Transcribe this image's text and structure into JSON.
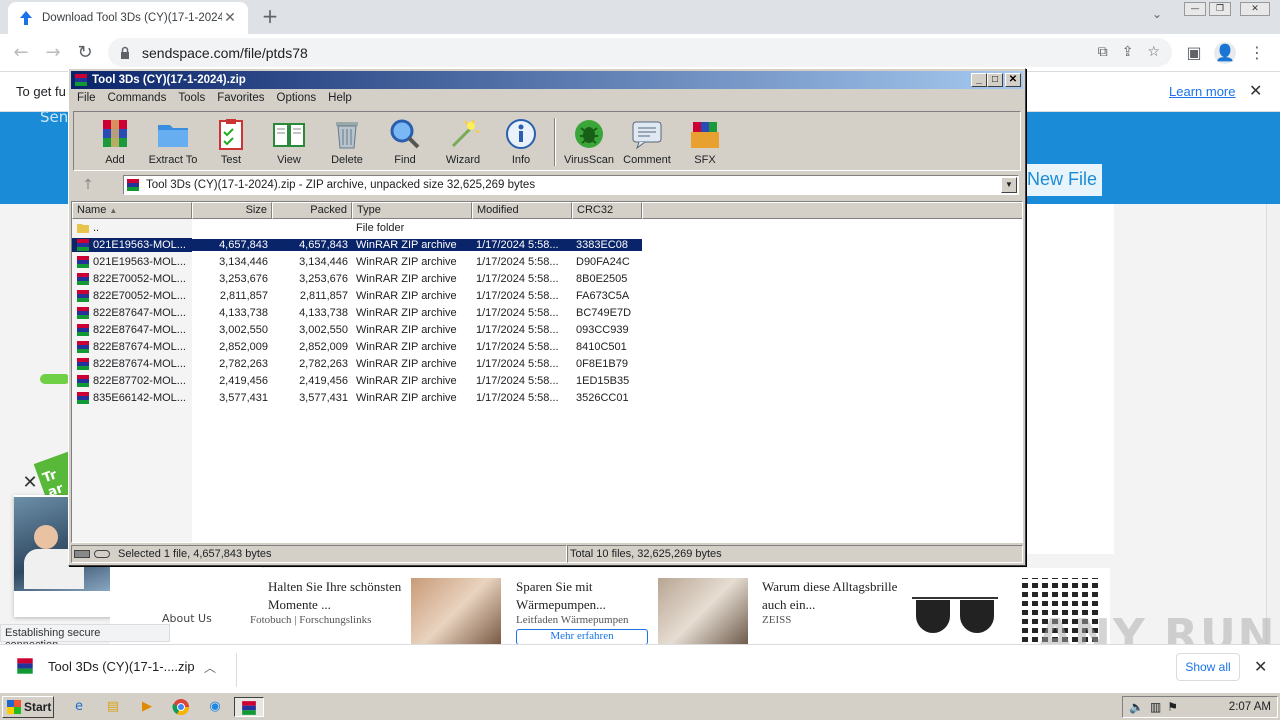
{
  "browser": {
    "tab_title": "Download Tool 3Ds (CY)(17-1-2024)",
    "url": "sendspace.com/file/ptds78"
  },
  "page": {
    "infobar_text": "To get fu",
    "learn_more": "Learn more",
    "banner_text": "Sen",
    "new_file_button": "New File",
    "badge_text": "Tr ar",
    "status_text": "Establishing secure connection...",
    "about_us": "About Us",
    "ads": [
      {
        "title": "Halten Sie Ihre schönsten Momente ...",
        "sub": "Fotobuch | Forschungslinks"
      },
      {
        "title": "Sparen Sie mit Wärmepumpen...",
        "sub": "Leitfaden Wärmepumpen",
        "button": "Mehr erfahren"
      },
      {
        "title": "Warum diese Alltagsbrille auch ein...",
        "sub": "ZEISS"
      }
    ],
    "watermark": "ANY RUN"
  },
  "downloads": {
    "item_name": "Tool 3Ds (CY)(17-1-....zip",
    "show_all": "Show all"
  },
  "taskbar": {
    "start": "Start",
    "clock": "2:07 AM"
  },
  "winrar": {
    "title": "Tool 3Ds (CY)(17-1-2024).zip",
    "menu": [
      "File",
      "Commands",
      "Tools",
      "Favorites",
      "Options",
      "Help"
    ],
    "tools": [
      {
        "label": "Add",
        "icon": "add-archive-icon"
      },
      {
        "label": "Extract To",
        "icon": "extract-folder-icon"
      },
      {
        "label": "Test",
        "icon": "test-clipboard-icon"
      },
      {
        "label": "View",
        "icon": "view-book-icon"
      },
      {
        "label": "Delete",
        "icon": "trash-icon"
      },
      {
        "label": "Find",
        "icon": "magnifier-icon"
      },
      {
        "label": "Wizard",
        "icon": "wand-icon"
      },
      {
        "label": "Info",
        "icon": "info-icon"
      },
      {
        "label": "VirusScan",
        "icon": "virus-scan-icon"
      },
      {
        "label": "Comment",
        "icon": "comment-icon"
      },
      {
        "label": "SFX",
        "icon": "sfx-box-icon"
      }
    ],
    "path": "Tool 3Ds (CY)(17-1-2024).zip - ZIP archive, unpacked size 32,625,269 bytes",
    "columns": [
      "Name",
      "Size",
      "Packed",
      "Type",
      "Modified",
      "CRC32"
    ],
    "parent_row": {
      "name": "..",
      "type": "File folder"
    },
    "files": [
      {
        "name": "021E19563-MOL...",
        "size": "4,657,843",
        "packed": "4,657,843",
        "type": "WinRAR ZIP archive",
        "modified": "1/17/2024 5:58...",
        "crc": "3383EC08",
        "selected": true
      },
      {
        "name": "021E19563-MOL...",
        "size": "3,134,446",
        "packed": "3,134,446",
        "type": "WinRAR ZIP archive",
        "modified": "1/17/2024 5:58...",
        "crc": "D90FA24C"
      },
      {
        "name": "822E70052-MOL...",
        "size": "3,253,676",
        "packed": "3,253,676",
        "type": "WinRAR ZIP archive",
        "modified": "1/17/2024 5:58...",
        "crc": "8B0E2505"
      },
      {
        "name": "822E70052-MOL...",
        "size": "2,811,857",
        "packed": "2,811,857",
        "type": "WinRAR ZIP archive",
        "modified": "1/17/2024 5:58...",
        "crc": "FA673C5A"
      },
      {
        "name": "822E87647-MOL...",
        "size": "4,133,738",
        "packed": "4,133,738",
        "type": "WinRAR ZIP archive",
        "modified": "1/17/2024 5:58...",
        "crc": "BC749E7D"
      },
      {
        "name": "822E87647-MOL...",
        "size": "3,002,550",
        "packed": "3,002,550",
        "type": "WinRAR ZIP archive",
        "modified": "1/17/2024 5:58...",
        "crc": "093CC939"
      },
      {
        "name": "822E87674-MOL...",
        "size": "2,852,009",
        "packed": "2,852,009",
        "type": "WinRAR ZIP archive",
        "modified": "1/17/2024 5:58...",
        "crc": "8410C501"
      },
      {
        "name": "822E87674-MOL...",
        "size": "2,782,263",
        "packed": "2,782,263",
        "type": "WinRAR ZIP archive",
        "modified": "1/17/2024 5:58...",
        "crc": "0F8E1B79"
      },
      {
        "name": "822E87702-MOL...",
        "size": "2,419,456",
        "packed": "2,419,456",
        "type": "WinRAR ZIP archive",
        "modified": "1/17/2024 5:58...",
        "crc": "1ED15B35"
      },
      {
        "name": "835E66142-MOL...",
        "size": "3,577,431",
        "packed": "3,577,431",
        "type": "WinRAR ZIP archive",
        "modified": "1/17/2024 5:58...",
        "crc": "3526CC01"
      }
    ],
    "status_left": "Selected 1 file, 4,657,843 bytes",
    "status_right": "Total 10 files, 32,625,269 bytes"
  },
  "colors": {
    "selection": "#0a246a",
    "title_gradient_start": "#0a246a",
    "title_gradient_end": "#a6caf0",
    "site_blue": "#1a8bd6"
  }
}
